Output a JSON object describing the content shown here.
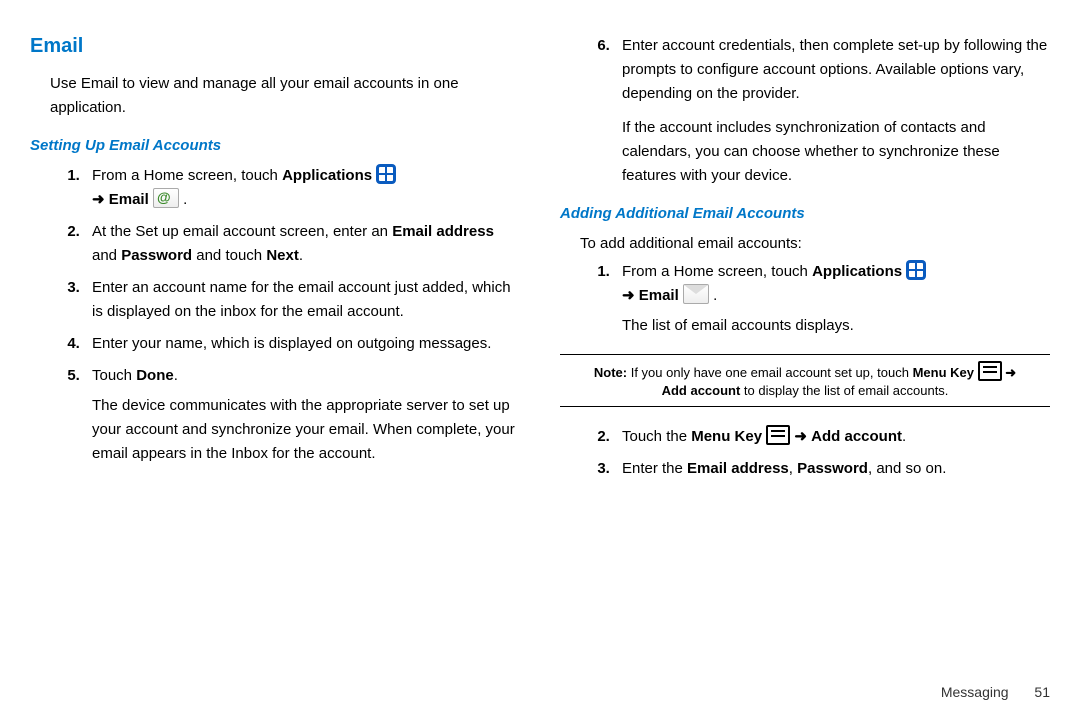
{
  "leftCol": {
    "sectionTitle": "Email",
    "intro": "Use Email to view and manage all your email accounts in one application.",
    "subhead": "Setting Up Email Accounts",
    "step1_a": "From a Home screen, touch ",
    "step1_apps": "Applications",
    "step1_b": "Email",
    "step2_a": "At the Set up email account screen, enter an ",
    "step2_b": "Email address",
    "step2_c": " and ",
    "step2_d": "Password",
    "step2_e": " and touch ",
    "step2_f": "Next",
    "step2_g": ".",
    "step3": "Enter an account name for the email account just added, which is displayed on the inbox for the email account.",
    "step4": "Enter your name, which is displayed on outgoing messages.",
    "step5_a": "Touch ",
    "step5_b": "Done",
    "step5_c": ".",
    "step5_follow": "The device communicates with the appropriate server to set up your account and synchronize your email. When complete, your email appears in the Inbox for the account."
  },
  "rightCol": {
    "step6": "Enter account credentials, then complete set-up by following the prompts to configure account options. Available options vary, depending on the provider.",
    "step6_follow": "If the account includes synchronization of contacts and calendars, you can choose whether to synchronize these features with your device.",
    "subhead2": "Adding Additional Email Accounts",
    "intro2": "To add additional email accounts:",
    "add_step1_a": "From a Home screen, touch ",
    "add_step1_apps": "Applications",
    "add_step1_b": "Email",
    "add_step1_follow": "The list of email accounts displays.",
    "note_a": "Note:",
    "note_b": " If you only have one email account set up, touch ",
    "note_c": "Menu Key",
    "note_d": "Add account",
    "note_e": " to display the list of email accounts.",
    "add_step2_a": "Touch the ",
    "add_step2_b": "Menu Key",
    "add_step2_c": "Add account",
    "add_step2_d": ".",
    "add_step3_a": "Enter the ",
    "add_step3_b": "Email address",
    "add_step3_c": ", ",
    "add_step3_d": "Password",
    "add_step3_e": ", and so on."
  },
  "footer": {
    "chapter": "Messaging",
    "page": "51"
  },
  "arrow": "➜"
}
